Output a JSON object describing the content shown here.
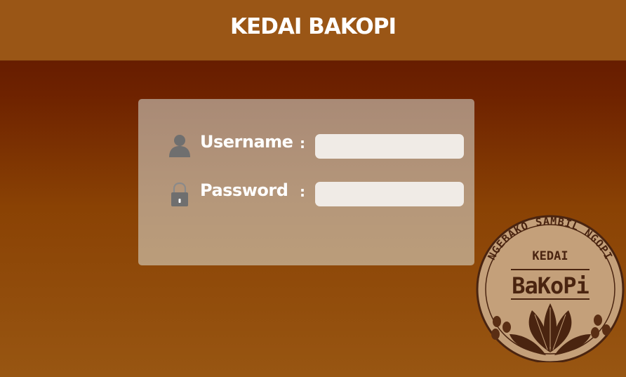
{
  "header": {
    "title": "KEDAI BAKOPI"
  },
  "login": {
    "username_label": "Username",
    "password_label": "Password",
    "separator": ":",
    "username_value": "",
    "password_value": "",
    "username_icon": "user-icon",
    "password_icon": "padlock-icon"
  },
  "logo": {
    "ring_text": "NGEBAKO SAMBIL NGOPI",
    "top_text": "KEDAI",
    "brand_text": "BaKoPi"
  },
  "colors": {
    "header_bg": "#9a5616",
    "page_top": "#5a1400",
    "page_bottom": "#985612",
    "card_bg": "#b0917a",
    "input_bg": "#f0ebe6",
    "logo_bg": "#c4a07a",
    "logo_ink": "#4a2410"
  }
}
